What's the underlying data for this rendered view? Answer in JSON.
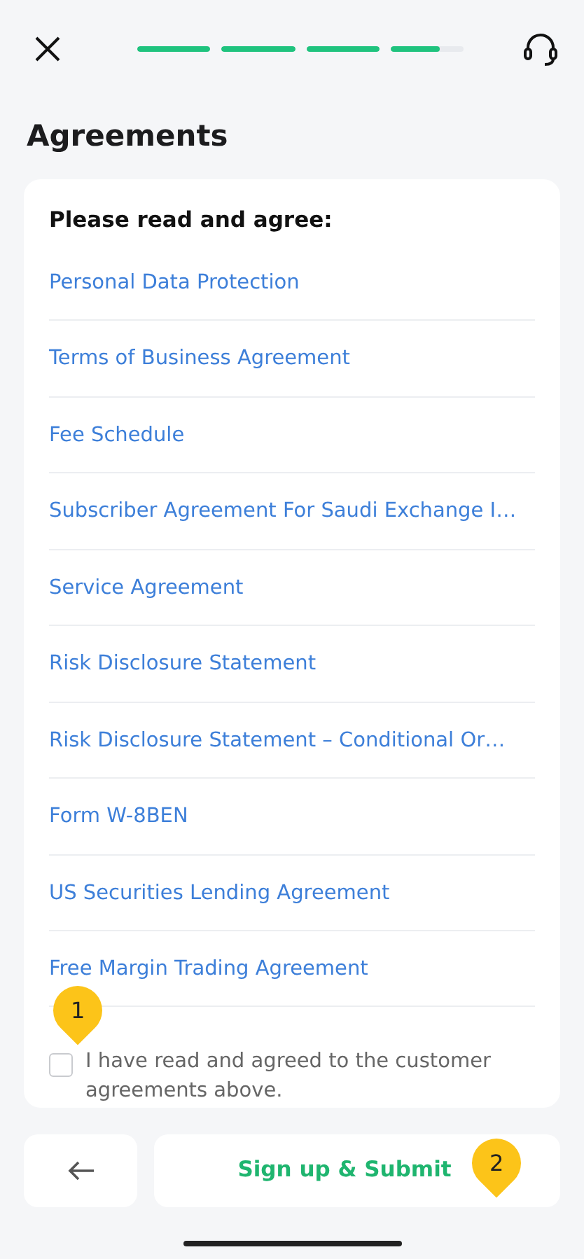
{
  "progress": [
    {
      "level": 1
    },
    {
      "level": 1
    },
    {
      "level": 1
    },
    {
      "level": 0.68
    }
  ],
  "title": "Agreements",
  "card": {
    "heading": "Please read and agree:",
    "links": [
      "Personal Data Protection",
      "Terms of Business Agreement",
      "Fee Schedule",
      "Subscriber Agreement For Saudi Exchange I…",
      "Service Agreement",
      "Risk Disclosure Statement",
      "Risk Disclosure Statement – Conditional Or…",
      "Form W-8BEN",
      "US Securities Lending Agreement",
      "Free Margin Trading Agreement"
    ],
    "consent": {
      "text": "I have read and agreed to the customer agreements above.",
      "checked": false
    }
  },
  "submit_button": "Sign up & Submit",
  "markers": [
    "1",
    "2"
  ]
}
